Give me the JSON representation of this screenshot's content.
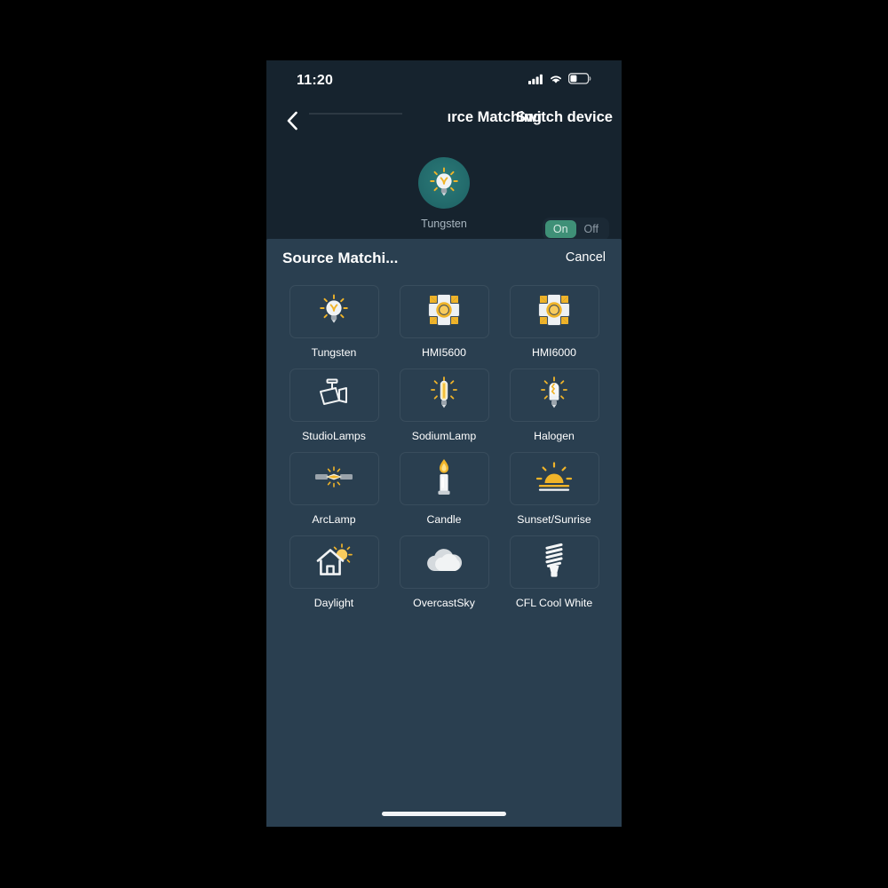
{
  "statusbar": {
    "time": "11:20",
    "signal_icon": "cellular-signal-icon",
    "wifi_icon": "wifi-icon",
    "battery_icon": "battery-icon",
    "battery_level_pct": 35
  },
  "navbar": {
    "back_icon": "back-chevron-icon",
    "title": "ırce Matching",
    "action_label": "Switch device"
  },
  "device": {
    "icon": "light-bulb-icon",
    "name": "Tungsten",
    "toggle": {
      "on_label": "On",
      "off_label": "Off",
      "selected": "On",
      "active_color": "#3f9077"
    }
  },
  "sheet": {
    "title": "Source Matchi...",
    "cancel_label": "Cancel",
    "sources": [
      {
        "label": "Tungsten",
        "icon": "light-bulb-icon"
      },
      {
        "label": "HMI5600",
        "icon": "fresnel-light-icon"
      },
      {
        "label": "HMI6000",
        "icon": "fresnel-light-icon"
      },
      {
        "label": "StudioLamps",
        "icon": "studio-lamp-icon"
      },
      {
        "label": "SodiumLamp",
        "icon": "sodium-lamp-icon"
      },
      {
        "label": "Halogen",
        "icon": "halogen-bulb-icon"
      },
      {
        "label": "ArcLamp",
        "icon": "arc-lamp-icon"
      },
      {
        "label": "Candle",
        "icon": "candle-icon"
      },
      {
        "label": "Sunset/Sunrise",
        "icon": "sunset-sunrise-icon"
      },
      {
        "label": "Daylight",
        "icon": "house-sun-icon"
      },
      {
        "label": "OvercastSky",
        "icon": "cloud-icon"
      },
      {
        "label": "CFL Cool White",
        "icon": "cfl-spiral-bulb-icon"
      }
    ]
  },
  "home_indicator": "home-indicator"
}
